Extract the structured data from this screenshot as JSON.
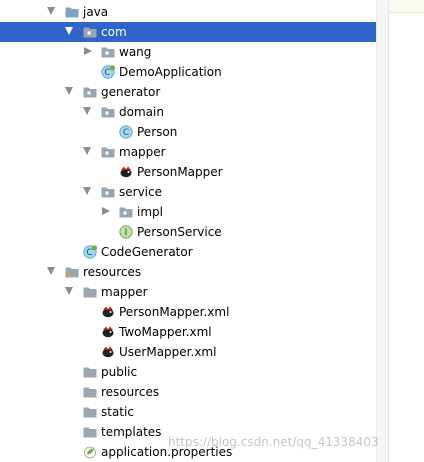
{
  "tree": [
    {
      "label": "java",
      "expanded": true,
      "icon": "source-folder-icon"
    },
    {
      "label": "com",
      "expanded": true,
      "icon": "package-folder-icon",
      "selected": true
    },
    {
      "label": "wang",
      "expanded": false,
      "icon": "package-folder-icon"
    },
    {
      "label": "DemoApplication",
      "icon": "spring-boot-class-icon"
    },
    {
      "label": "generator",
      "expanded": true,
      "icon": "package-folder-icon"
    },
    {
      "label": "domain",
      "expanded": true,
      "icon": "package-folder-icon"
    },
    {
      "label": "Person",
      "icon": "class-icon"
    },
    {
      "label": "mapper",
      "expanded": true,
      "icon": "package-folder-icon"
    },
    {
      "label": "PersonMapper",
      "icon": "mybatis-bird-icon"
    },
    {
      "label": "service",
      "expanded": true,
      "icon": "package-folder-icon"
    },
    {
      "label": "impl",
      "expanded": false,
      "icon": "package-folder-icon"
    },
    {
      "label": "PersonService",
      "icon": "interface-icon"
    },
    {
      "label": "CodeGenerator",
      "icon": "spring-boot-class-icon"
    },
    {
      "label": "resources",
      "expanded": true,
      "icon": "resources-folder-icon"
    },
    {
      "label": "mapper",
      "expanded": true,
      "icon": "folder-icon"
    },
    {
      "label": "PersonMapper.xml",
      "icon": "mybatis-bird-icon"
    },
    {
      "label": "TwoMapper.xml",
      "icon": "mybatis-bird-icon"
    },
    {
      "label": "UserMapper.xml",
      "icon": "mybatis-bird-icon"
    },
    {
      "label": "public",
      "icon": "folder-icon"
    },
    {
      "label": "resources",
      "icon": "folder-icon"
    },
    {
      "label": "static",
      "icon": "folder-icon"
    },
    {
      "label": "templates",
      "icon": "folder-icon"
    },
    {
      "label": "application.properties",
      "icon": "spring-properties-icon"
    }
  ],
  "watermark": "https://blog.csdn.net/qq_41338403",
  "colors": {
    "selection": "#2f65ca",
    "folder": "#9aa7b0",
    "class_circle": "#3aa0c8",
    "interface_circle": "#5e9e3a",
    "spring": "#6db33f"
  }
}
